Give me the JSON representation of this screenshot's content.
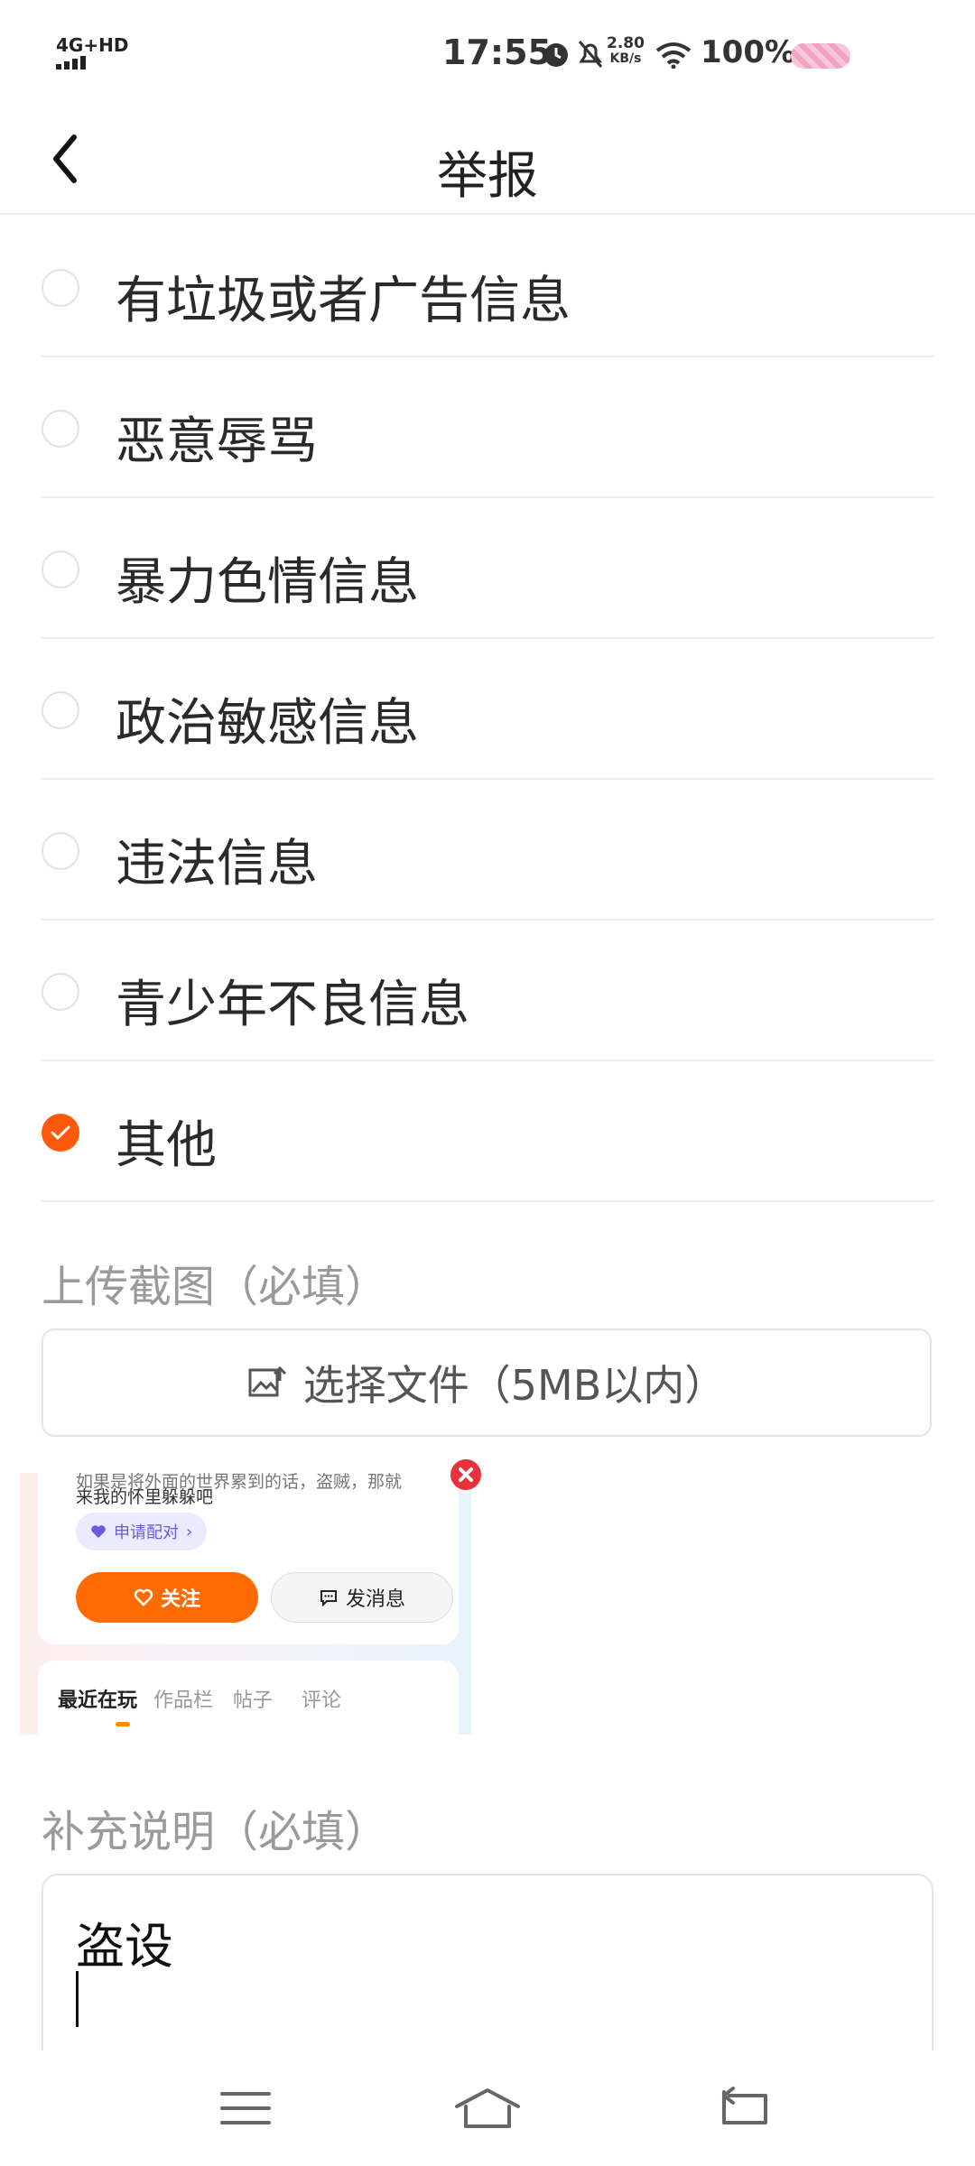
{
  "status_bar": {
    "network": "4G+HD",
    "time": "17:55",
    "speed_value": "2.80",
    "speed_unit": "KB/s",
    "battery": "100%"
  },
  "header": {
    "title": "举报",
    "back_icon": "chevron-left-icon"
  },
  "options": [
    {
      "label": "有垃圾或者广告信息",
      "checked": false
    },
    {
      "label": "恶意辱骂",
      "checked": false
    },
    {
      "label": "暴力色情信息",
      "checked": false
    },
    {
      "label": "政治敏感信息",
      "checked": false
    },
    {
      "label": "违法信息",
      "checked": false
    },
    {
      "label": "青少年不良信息",
      "checked": false
    },
    {
      "label": "其他",
      "checked": true
    }
  ],
  "upload": {
    "label": "上传截图（必填）",
    "button": "选择文件（5MB以内）",
    "icon": "image-upload-icon"
  },
  "thumbnail": {
    "cut_text": "如果是将外面的世界累到的话，盗贼，那就",
    "text": "来我的怀里躲躲吧",
    "pair_tag": "申请配对",
    "follow": "关注",
    "message": "发消息",
    "tabs": [
      "最近在玩",
      "作品栏",
      "帖子",
      "评论"
    ]
  },
  "description": {
    "label": "补充说明（必填）",
    "value": "盗设"
  },
  "colors": {
    "accent": "#ff5a0a",
    "follow": "#ff6b00",
    "close": "#e8323a"
  }
}
